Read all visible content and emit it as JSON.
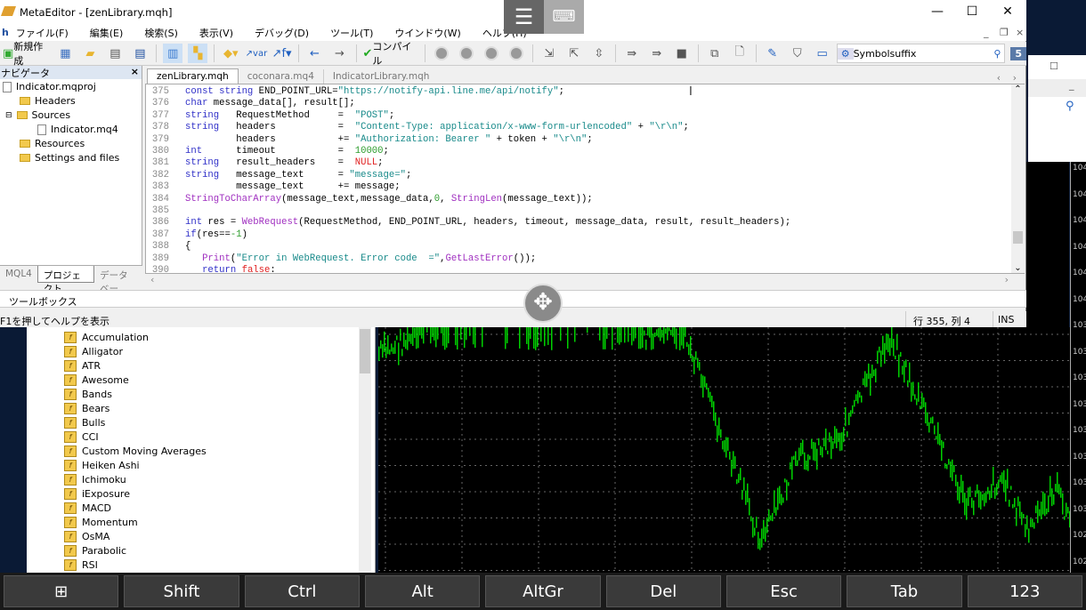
{
  "window": {
    "title": "MetaEditor - [zenLibrary.mqh]",
    "minimize": "—",
    "maximize": "☐",
    "close": "✕"
  },
  "menu": [
    "ファイル(F)",
    "編集(E)",
    "検索(S)",
    "表示(V)",
    "デバッグ(D)",
    "ツール(T)",
    "ウインドウ(W)",
    "ヘルプ(H)"
  ],
  "toolbar": {
    "new_label": "新規作成",
    "compile_label": "コンパイル",
    "search_value": "Symbolsuffix",
    "notif_count": "5"
  },
  "navigator": {
    "title": "ナビゲータ",
    "close": "×",
    "items": [
      {
        "label": "Indicator.mqproj",
        "type": "file"
      },
      {
        "label": "Headers",
        "type": "folder"
      },
      {
        "label": "Sources",
        "type": "folder"
      },
      {
        "label": "Indicator.mq4",
        "type": "file"
      },
      {
        "label": "Resources",
        "type": "folder"
      },
      {
        "label": "Settings and files",
        "type": "folder"
      }
    ],
    "tabs": [
      "MQL4",
      "プロジェクト",
      "データベー"
    ]
  },
  "editor": {
    "tabs": [
      "zenLibrary.mqh",
      "coconara.mq4",
      "IndicatorLibrary.mqh"
    ],
    "lines": [
      {
        "n": "375",
        "t": [
          [
            "kw",
            "const string "
          ],
          [
            "",
            "END_POINT_URL="
          ],
          [
            "st",
            "\"https://notify-api.line.me/api/notify\""
          ],
          [
            "",
            ";"
          ]
        ]
      },
      {
        "n": "376",
        "t": [
          [
            "kw",
            "char "
          ],
          [
            "",
            "message_data[], result[];"
          ]
        ]
      },
      {
        "n": "377",
        "t": [
          [
            "kw",
            "string   "
          ],
          [
            "",
            "RequestMethod     =  "
          ],
          [
            "st",
            "\"POST\""
          ],
          [
            "",
            ";"
          ]
        ]
      },
      {
        "n": "378",
        "t": [
          [
            "kw",
            "string   "
          ],
          [
            "",
            "headers           =  "
          ],
          [
            "st",
            "\"Content-Type: application/x-www-form-urlencoded\""
          ],
          [
            "",
            " + "
          ],
          [
            "st",
            "\"\\r\\n\""
          ],
          [
            "",
            ";"
          ]
        ]
      },
      {
        "n": "379",
        "t": [
          [
            "",
            "         headers           += "
          ],
          [
            "st",
            "\"Authorization: Bearer \""
          ],
          [
            "",
            " + token + "
          ],
          [
            "st",
            "\"\\r\\n\""
          ],
          [
            "",
            ";"
          ]
        ]
      },
      {
        "n": "380",
        "t": [
          [
            "kw",
            "int      "
          ],
          [
            "",
            "timeout           =  "
          ],
          [
            "nu",
            "10000"
          ],
          [
            "",
            ";"
          ]
        ]
      },
      {
        "n": "381",
        "t": [
          [
            "kw",
            "string   "
          ],
          [
            "",
            "result_headers    =  "
          ],
          [
            "rd",
            "NULL"
          ],
          [
            "",
            ";"
          ]
        ]
      },
      {
        "n": "382",
        "t": [
          [
            "kw",
            "string   "
          ],
          [
            "",
            "message_text      = "
          ],
          [
            "st",
            "\"message=\""
          ],
          [
            "",
            ";"
          ]
        ]
      },
      {
        "n": "383",
        "t": [
          [
            "",
            "         message_text      += message;"
          ]
        ]
      },
      {
        "n": "384",
        "t": [
          [
            "fn",
            "StringToCharArray"
          ],
          [
            "",
            "(message_text,message_data,"
          ],
          [
            "nu",
            "0"
          ],
          [
            "",
            ", "
          ],
          [
            "fn",
            "StringLen"
          ],
          [
            "",
            "(message_text));"
          ]
        ]
      },
      {
        "n": "385",
        "t": []
      },
      {
        "n": "386",
        "t": [
          [
            "kw",
            "int "
          ],
          [
            "",
            "res = "
          ],
          [
            "fn",
            "WebRequest"
          ],
          [
            "",
            "(RequestMethod, END_POINT_URL, headers, timeout, message_data, result, result_headers);"
          ]
        ]
      },
      {
        "n": "387",
        "t": [
          [
            "kw",
            "if"
          ],
          [
            "",
            "(res=="
          ],
          [
            "nu",
            "-1"
          ],
          [
            "",
            ")"
          ]
        ]
      },
      {
        "n": "388",
        "t": [
          [
            "",
            "{"
          ]
        ]
      },
      {
        "n": "389",
        "t": [
          [
            "",
            "   "
          ],
          [
            "fn",
            "Print"
          ],
          [
            "",
            "("
          ],
          [
            "st",
            "\"Error in WebRequest. Error code  =\""
          ],
          [
            "",
            ","
          ],
          [
            "fn",
            "GetLastError"
          ],
          [
            "",
            "());"
          ]
        ]
      },
      {
        "n": "390",
        "t": [
          [
            "",
            "   "
          ],
          [
            "kw",
            "return "
          ],
          [
            "rd",
            "false"
          ],
          [
            "",
            ":"
          ]
        ]
      }
    ]
  },
  "toolbox": {
    "label": "ツールボックス"
  },
  "status": {
    "help": "F1を押してヘルプを表示",
    "position": "行 355, 列 4",
    "mode": "INS"
  },
  "indicators": [
    "Accumulation",
    "Alligator",
    "ATR",
    "Awesome",
    "Bands",
    "Bears",
    "Bulls",
    "CCI",
    "Custom Moving Averages",
    "Heiken Ashi",
    "Ichimoku",
    "iExposure",
    "MACD",
    "Momentum",
    "OsMA",
    "Parabolic",
    "RSI"
  ],
  "chart": {
    "price_labels": [
      "104",
      "104",
      "104",
      "104",
      "104",
      "104",
      "103",
      "103",
      "103",
      "103",
      "103",
      "103",
      "103",
      "103",
      "102",
      "102"
    ],
    "bar_color": "#00d000"
  },
  "keys": [
    "Shift",
    "Ctrl",
    "Alt",
    "AltGr",
    "Del",
    "Esc",
    "Tab",
    "123"
  ],
  "colors": {
    "keyword": "#3030c8",
    "string": "#188a8a",
    "number": "#2c9c2c",
    "constant": "#e02020",
    "function": "#a030c0"
  }
}
